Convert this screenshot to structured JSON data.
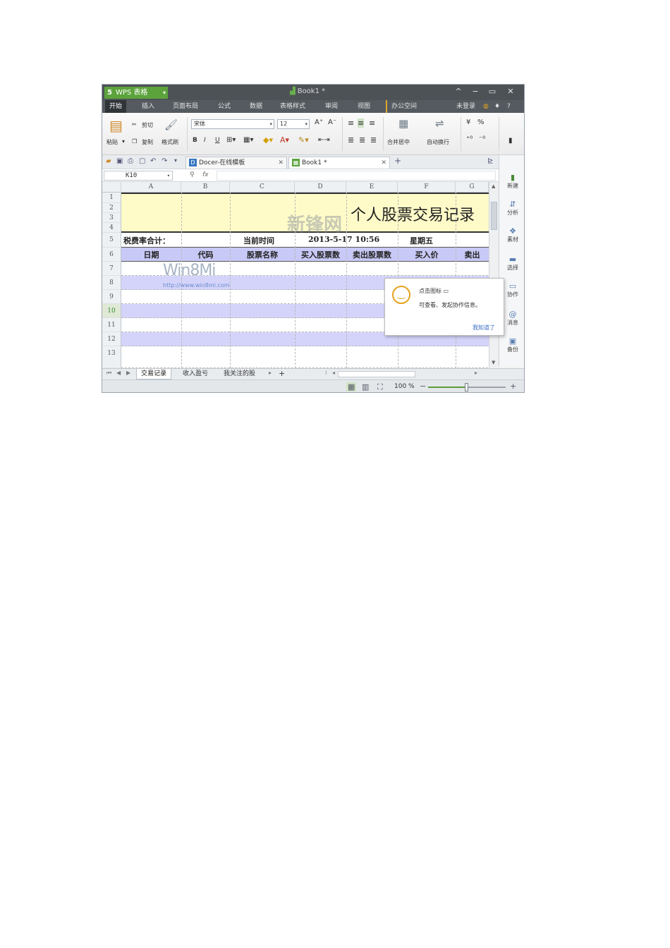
{
  "app": {
    "logo": "WPS 表格",
    "logo_mark": "5",
    "document_title": "Book1 *"
  },
  "window_controls": {
    "up": "^",
    "minimize": "−",
    "restore": "▭",
    "close": "✕"
  },
  "menu": {
    "items": [
      "开始",
      "插入",
      "页面布局",
      "公式",
      "数据",
      "表格样式",
      "审阅",
      "视图",
      "办公空间"
    ],
    "active_index": 0,
    "login": "未登录",
    "help": "?"
  },
  "ribbon": {
    "paste": "粘贴",
    "cut": "剪切",
    "copy": "复制",
    "format_painter": "格式刷",
    "font_name": "宋体",
    "font_size": "12",
    "bold": "B",
    "italic": "I",
    "underline": "U",
    "grow_font": "A⁺",
    "shrink_font": "A⁻",
    "merge_center": "合并居中",
    "wrap_text": "自动换行",
    "percent": "%"
  },
  "doc_tabs": [
    {
      "label": "Docer-在线模板",
      "icon": "D"
    },
    {
      "label": "Book1 *",
      "icon": "▦"
    }
  ],
  "formula_bar": {
    "cell_ref": "K10",
    "fx": "fx"
  },
  "grid": {
    "columns": [
      "A",
      "B",
      "C",
      "D",
      "E",
      "F",
      "G"
    ],
    "rows": [
      "1",
      "2",
      "3",
      "4",
      "5",
      "6",
      "7",
      "8",
      "9",
      "10",
      "11",
      "12",
      "13"
    ],
    "selected_row": "10",
    "title": "个人股票交易记录",
    "row5": {
      "tax_total": "税费率合计：",
      "c5": "当前时间",
      "date": "2013-5-17 10:56",
      "weekday": "星期五"
    },
    "headers": [
      "日期",
      "代码",
      "股票名称",
      "买入股票数",
      "卖出股票数",
      "买入价",
      "卖出"
    ]
  },
  "watermarks": {
    "win8": "Win8Mi",
    "win8_url": "http://www.win8mi.com",
    "site": "新锋网"
  },
  "sidebar": [
    "新建",
    "分析",
    "素材",
    "选择",
    "协作",
    "消息",
    "备份"
  ],
  "tooltip": {
    "line1": "点击图标",
    "line2": "可查看、发起协作信息。",
    "dismiss": "我知道了"
  },
  "sheet_tabs": [
    "交易记录",
    "收入盈亏",
    "我关注的股"
  ],
  "sheet_add": "+",
  "status": {
    "zoom_label": "100 %",
    "zoom_value": 100
  },
  "colors": {
    "title_band": "#fffbc8",
    "header_band": "#c9c9f7",
    "stripe": "#d4d4fb",
    "logo_green": "#5ca33c",
    "titlebar": "#4d5257"
  }
}
